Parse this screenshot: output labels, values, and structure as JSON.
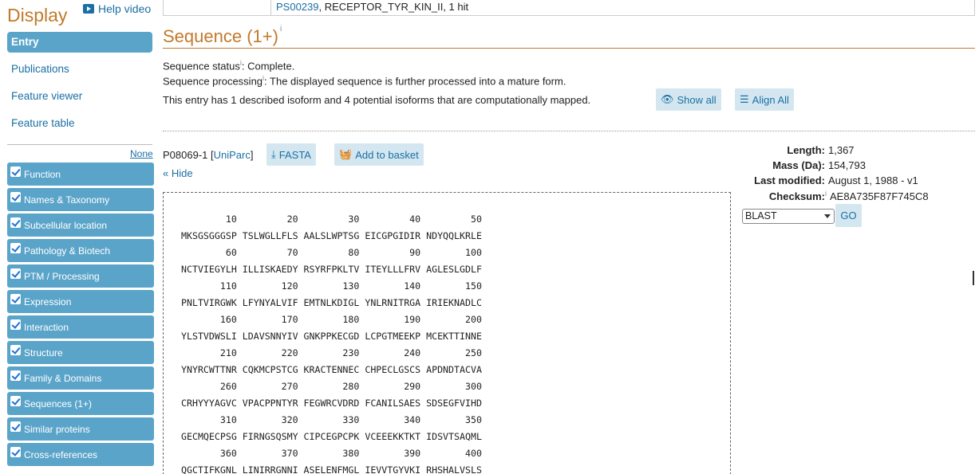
{
  "sidebar": {
    "title": "Display",
    "help_video": "Help video",
    "nav": [
      {
        "label": "Entry",
        "active": true
      },
      {
        "label": "Publications",
        "active": false
      },
      {
        "label": "Feature viewer",
        "active": false
      },
      {
        "label": "Feature table",
        "active": false
      }
    ],
    "none_label": "None",
    "sections": [
      "Function",
      "Names & Taxonomy",
      "Subcellular location",
      "Pathology & Biotech",
      "PTM / Processing",
      "Expression",
      "Interaction",
      "Structure",
      "Family & Domains",
      "Sequences (1+)",
      "Similar proteins",
      "Cross-references"
    ]
  },
  "top_row": {
    "link": "PS00239",
    "rest": ", RECEPTOR_TYR_KIN_II, 1 hit"
  },
  "section_title": "Sequence (1+)",
  "info_sup": "i",
  "status": {
    "label": "Sequence status",
    "value": ": Complete."
  },
  "processing": {
    "label": "Sequence processing",
    "value": ": The displayed sequence is further processed into a mature form."
  },
  "isoform_text": "This entry has 1 described isoform and 4 potential isoforms that are computationally mapped.",
  "buttons": {
    "show_all": "Show all",
    "align_all": "Align All",
    "fasta": "FASTA",
    "add_to_basket": "Add to basket",
    "go": "GO"
  },
  "entry": {
    "id": "P08069-1",
    "open": " [",
    "uniparc": "UniParc",
    "close": "]",
    "hide": "« Hide"
  },
  "sequence": {
    "rows": [
      {
        "nums": "        10         20         30         40         50",
        "seq": "MKSGSGGGSP TSLWGLLFLS AALSLWPTSG EICGPGIDIR NDYQQLKRLE"
      },
      {
        "nums": "        60         70         80         90        100",
        "seq": "NCTVIEGYLH ILLISKAEDY RSYRFPKLTV ITEYLLLFRV AGLESLGDLF"
      },
      {
        "nums": "       110        120        130        140        150",
        "seq": "PNLTVIRGWK LFYNYALVIF EMTNLKDIGL YNLRNITRGA IRIEKNADLC"
      },
      {
        "nums": "       160        170        180        190        200",
        "seq": "YLSTVDWSLI LDAVSNNYIV GNKPPKECGD LCPGTMEEKP MCEKTTINNE"
      },
      {
        "nums": "       210        220        230        240        250",
        "seq": "YNYRCWTTNR CQKMCPSTCG KRACTENNEC CHPECLGSCS APDNDTACVA"
      },
      {
        "nums": "       260        270        280        290        300",
        "seq": "CRHYYYAGVC VPACPPNTYR FEGWRCVDRD FCANILSAES SDSEGFVIHD"
      },
      {
        "nums": "       310        320        330        340        350",
        "seq": "GECMQECPSG FIRNGSQSMY CIPCEGPCPK VCEEEKKTKT IDSVTSAQML"
      },
      {
        "nums": "       360        370        380        390        400",
        "seq": "QGCTIFKGNL LINIRRGNNI ASELENFMGL IEVVTGYVKI RHSHALVSLS"
      }
    ]
  },
  "properties": {
    "length": {
      "label": "Length:",
      "value": "1,367"
    },
    "mass": {
      "label": "Mass (Da):",
      "value": "154,793"
    },
    "modified": {
      "label": "Last modified:",
      "value": "August 1, 1988 - v1"
    },
    "checksum": {
      "label": "Checksum:",
      "value": "AE8A735F87F745C8"
    }
  },
  "blast_select": "BLAST"
}
